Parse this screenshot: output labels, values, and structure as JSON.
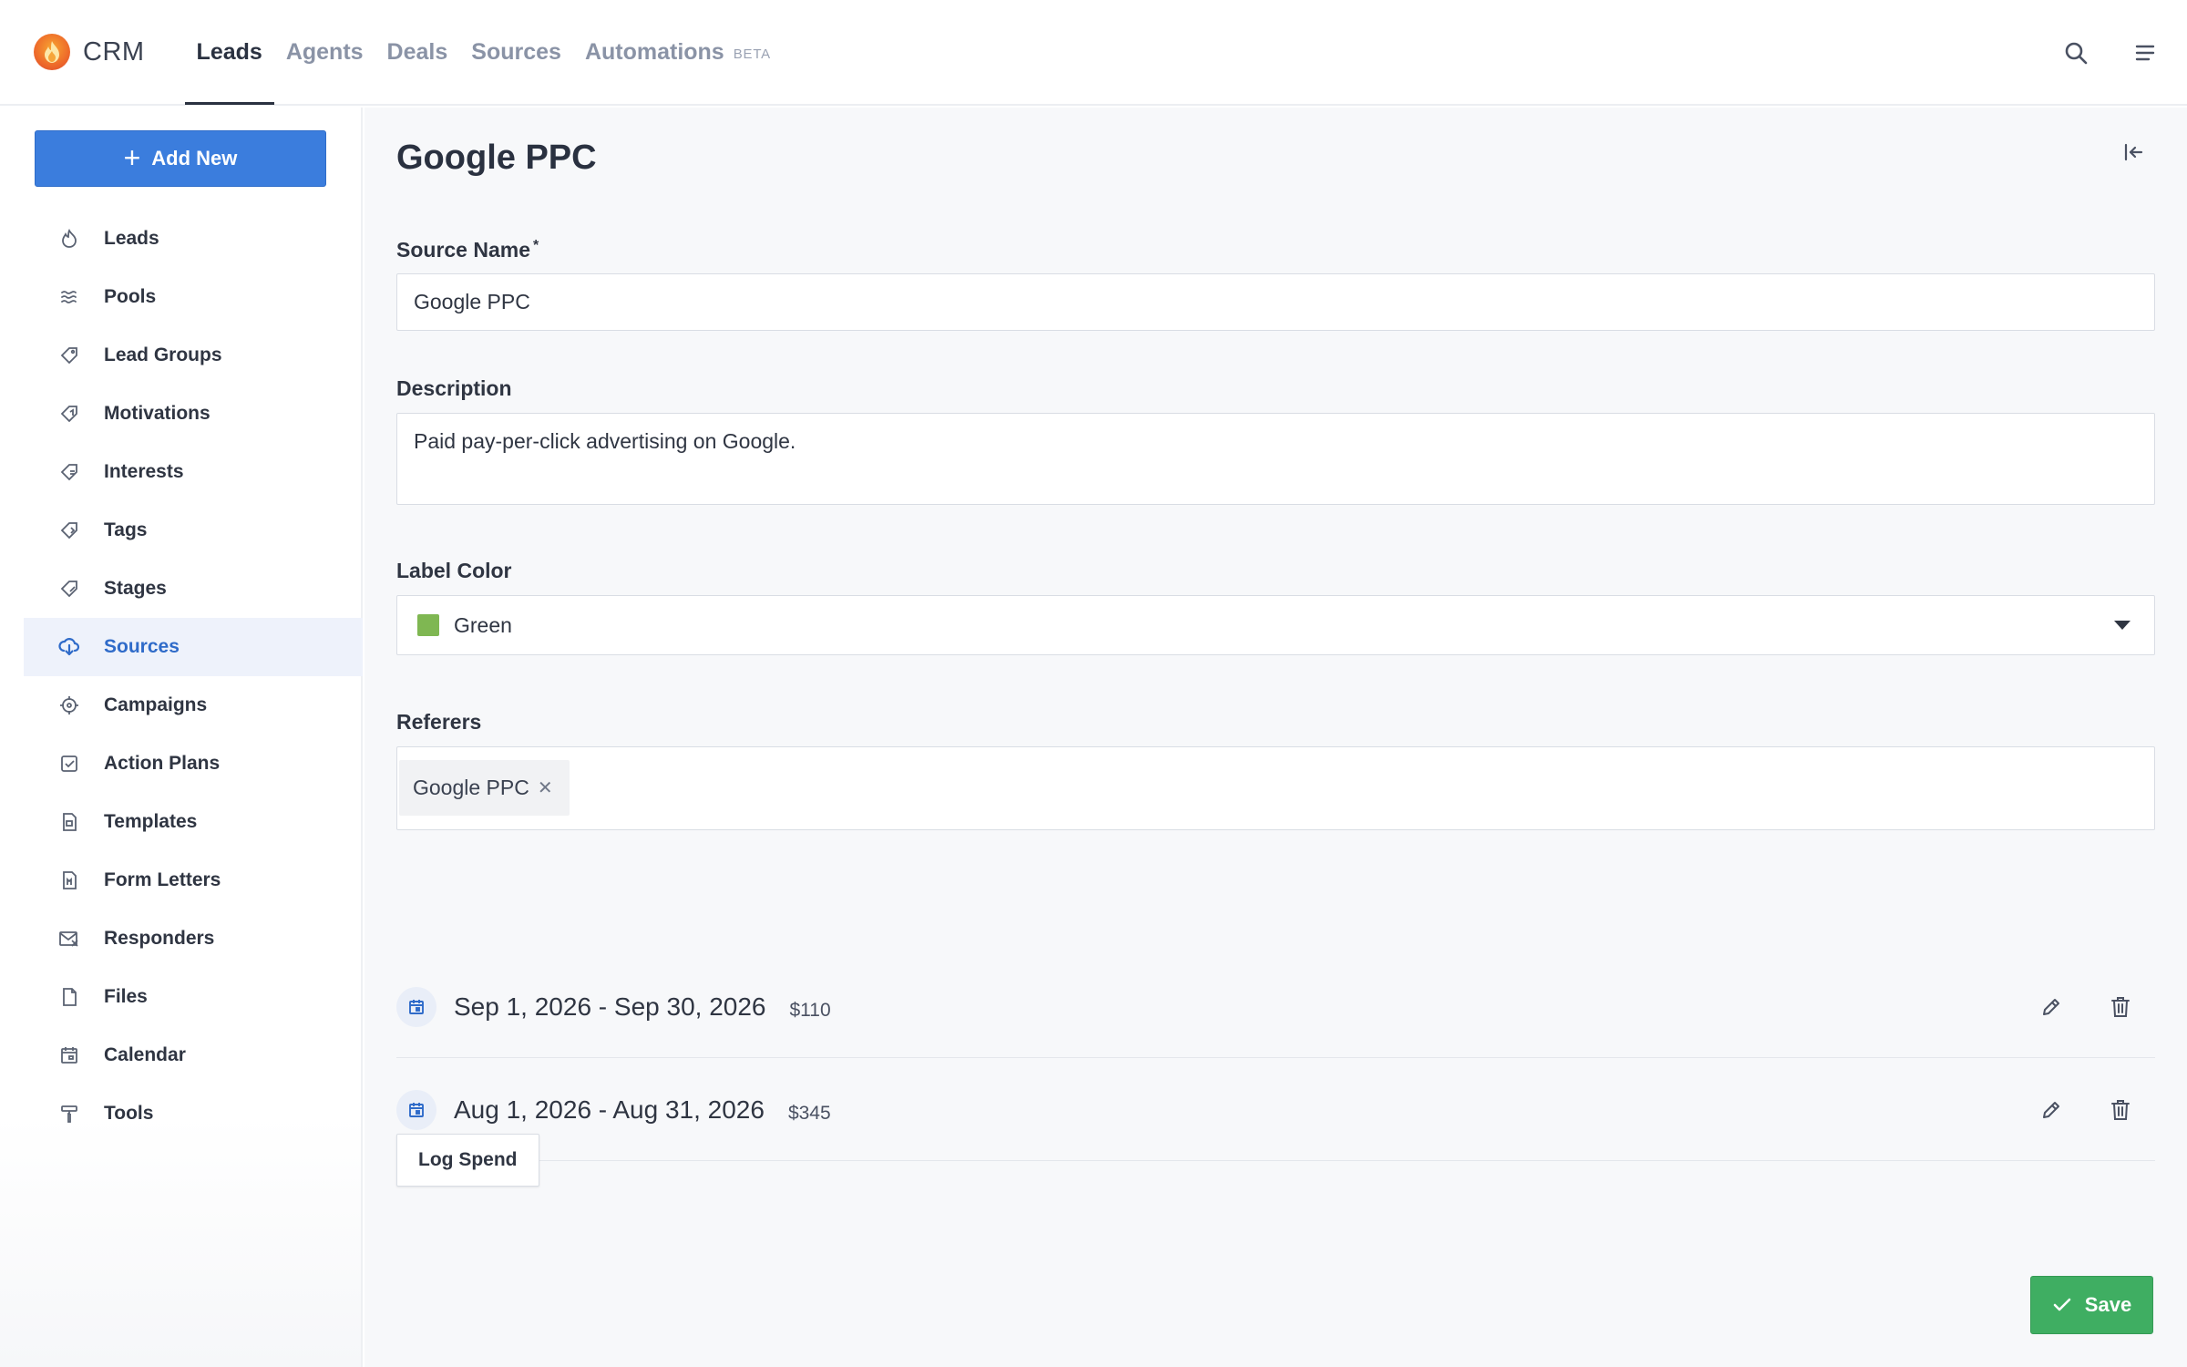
{
  "app": {
    "name": "CRM",
    "logo_icon": "flame-icon"
  },
  "topnav": [
    {
      "label": "Leads",
      "active": true
    },
    {
      "label": "Agents",
      "active": false
    },
    {
      "label": "Deals",
      "active": false
    },
    {
      "label": "Sources",
      "active": false
    },
    {
      "label": "Automations",
      "badge": "BETA",
      "active": false
    }
  ],
  "topbar_icons": [
    "search-icon",
    "menu-icon"
  ],
  "sidebar": {
    "add_button": "Add New",
    "items": [
      {
        "label": "Leads",
        "icon": "leads-icon"
      },
      {
        "label": "Pools",
        "icon": "pools-icon"
      },
      {
        "label": "Lead Groups",
        "icon": "tag-icon"
      },
      {
        "label": "Motivations",
        "icon": "motivations-icon"
      },
      {
        "label": "Interests",
        "icon": "interests-icon"
      },
      {
        "label": "Tags",
        "icon": "tags-icon"
      },
      {
        "label": "Stages",
        "icon": "stages-icon"
      },
      {
        "label": "Sources",
        "icon": "sources-icon",
        "active": true
      },
      {
        "label": "Campaigns",
        "icon": "crosshair-icon"
      },
      {
        "label": "Action Plans",
        "icon": "checkbox-icon"
      },
      {
        "label": "Templates",
        "icon": "template-icon"
      },
      {
        "label": "Form Letters",
        "icon": "form-letter-icon"
      },
      {
        "label": "Responders",
        "icon": "responders-icon"
      },
      {
        "label": "Files",
        "icon": "file-icon"
      },
      {
        "label": "Calendar",
        "icon": "calendar-icon"
      },
      {
        "label": "Tools",
        "icon": "paint-roller-icon"
      }
    ]
  },
  "main": {
    "title": "Google PPC",
    "source_name": {
      "label": "Source Name",
      "required_mark": "*",
      "value": "Google PPC"
    },
    "description": {
      "label": "Description",
      "value": "Paid pay-per-click advertising on Google."
    },
    "label_color": {
      "label": "Label Color",
      "value": "Green",
      "swatch": "#7fb752"
    },
    "referers": {
      "label": "Referers",
      "tags": [
        "Google PPC"
      ]
    },
    "spend_entries": [
      {
        "range": "Sep 1, 2026 - Sep 30, 2026",
        "amount": "$110"
      },
      {
        "range": "Aug 1, 2026 - Aug 31, 2026",
        "amount": "$345"
      }
    ],
    "log_spend_button": "Log Spend",
    "save_button": "Save"
  },
  "colors": {
    "primary": "#3b7ddd",
    "success": "#3fae62",
    "active_nav": "#2f6bc9"
  }
}
